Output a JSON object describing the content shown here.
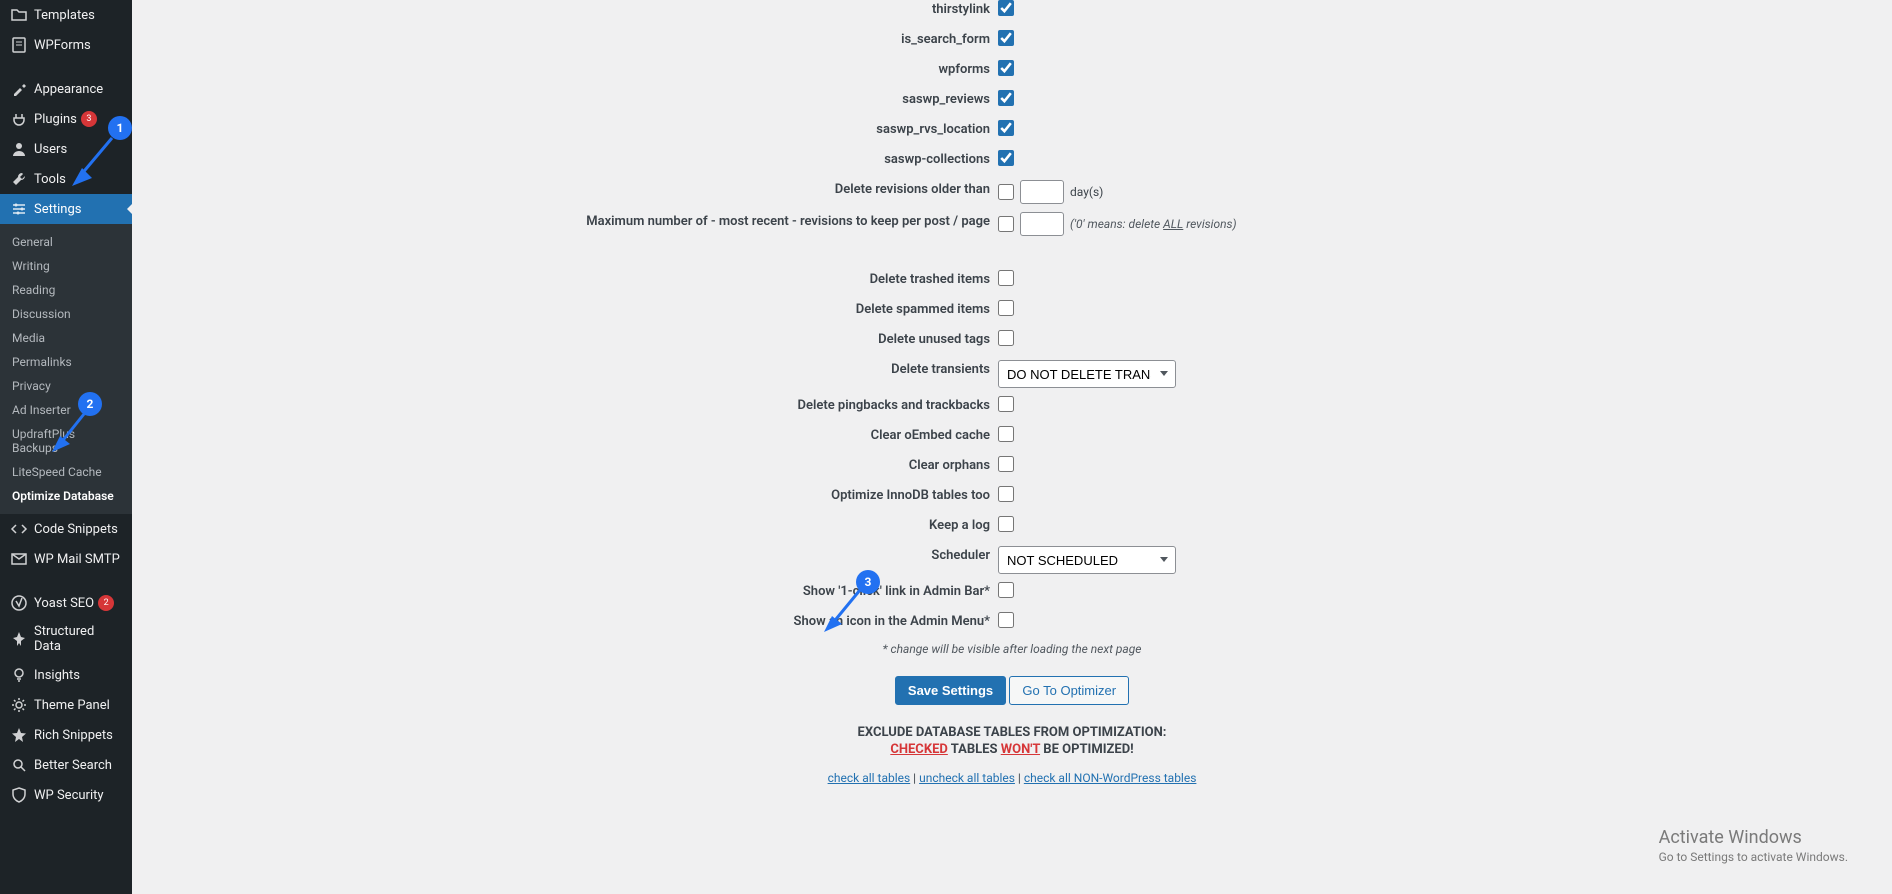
{
  "sidebar": {
    "topItems": [
      {
        "icon": "folder",
        "label": "Templates"
      },
      {
        "icon": "form",
        "label": "WPForms"
      },
      {
        "icon": "brush",
        "label": "Appearance"
      },
      {
        "icon": "plug",
        "label": "Plugins",
        "badge": "3"
      },
      {
        "icon": "user",
        "label": "Users"
      },
      {
        "icon": "wrench",
        "label": "Tools"
      },
      {
        "icon": "sliders",
        "label": "Settings",
        "active": true
      }
    ],
    "subItems": [
      "General",
      "Writing",
      "Reading",
      "Discussion",
      "Media",
      "Permalinks",
      "Privacy",
      "Ad Inserter",
      "UpdraftPlus Backups",
      "LiteSpeed Cache",
      "Optimize Database"
    ],
    "bottomItems": [
      {
        "icon": "code",
        "label": "Code Snippets"
      },
      {
        "icon": "mail",
        "label": "WP Mail SMTP"
      },
      {
        "icon": "yoast",
        "label": "Yoast SEO",
        "badge": "2"
      },
      {
        "icon": "pin",
        "label": "Structured Data"
      },
      {
        "icon": "bulb",
        "label": "Insights"
      },
      {
        "icon": "gear",
        "label": "Theme Panel"
      },
      {
        "icon": "star",
        "label": "Rich Snippets"
      },
      {
        "icon": "search",
        "label": "Better Search"
      },
      {
        "icon": "shield",
        "label": "WP Security"
      }
    ]
  },
  "checkItems": [
    {
      "label": "thirstylink",
      "checked": true
    },
    {
      "label": "is_search_form",
      "checked": true
    },
    {
      "label": "wpforms",
      "checked": true
    },
    {
      "label": "saswp_reviews",
      "checked": true
    },
    {
      "label": "saswp_rvs_location",
      "checked": true
    },
    {
      "label": "saswp-collections",
      "checked": true
    }
  ],
  "form": {
    "revOlder": {
      "label": "Delete revisions older than",
      "unit": "day(s)"
    },
    "maxRev": {
      "label": "Maximum number of - most recent - revisions to keep per post / page",
      "hintPrefix": "('0' means: delete ",
      "hintUnd": "ALL",
      "hintSuffix": " revisions)"
    },
    "trashed": "Delete trashed items",
    "spammed": "Delete spammed items",
    "tags": "Delete unused tags",
    "transients": {
      "label": "Delete transients",
      "value": "DO NOT DELETE TRANSIENTS"
    },
    "pingbacks": "Delete pingbacks and trackbacks",
    "oembed": "Clear oEmbed cache",
    "orphans": "Clear orphans",
    "innodb": "Optimize InnoDB tables too",
    "keeplog": "Keep a log",
    "scheduler": {
      "label": "Scheduler",
      "value": "NOT SCHEDULED"
    },
    "oneclick": "Show '1-click' link in Admin Bar*",
    "adminicon": "Show an icon in the Admin Menu*",
    "note": "* change will be visible after loading the next page"
  },
  "buttons": {
    "save": "Save Settings",
    "go": "Go To Optimizer"
  },
  "exclude": {
    "line1": "EXCLUDE DATABASE TABLES FROM OPTIMIZATION:",
    "checked": "CHECKED",
    "mid": " TABLES ",
    "wont": "WON'T",
    "end": " BE OPTIMIZED!",
    "links": {
      "a": "check all tables",
      "b": "uncheck all tables",
      "c": "check all NON-WordPress tables"
    }
  },
  "activate": {
    "title": "Activate Windows",
    "sub": "Go to Settings to activate Windows."
  },
  "annot": {
    "1": "1",
    "2": "2",
    "3": "3"
  }
}
